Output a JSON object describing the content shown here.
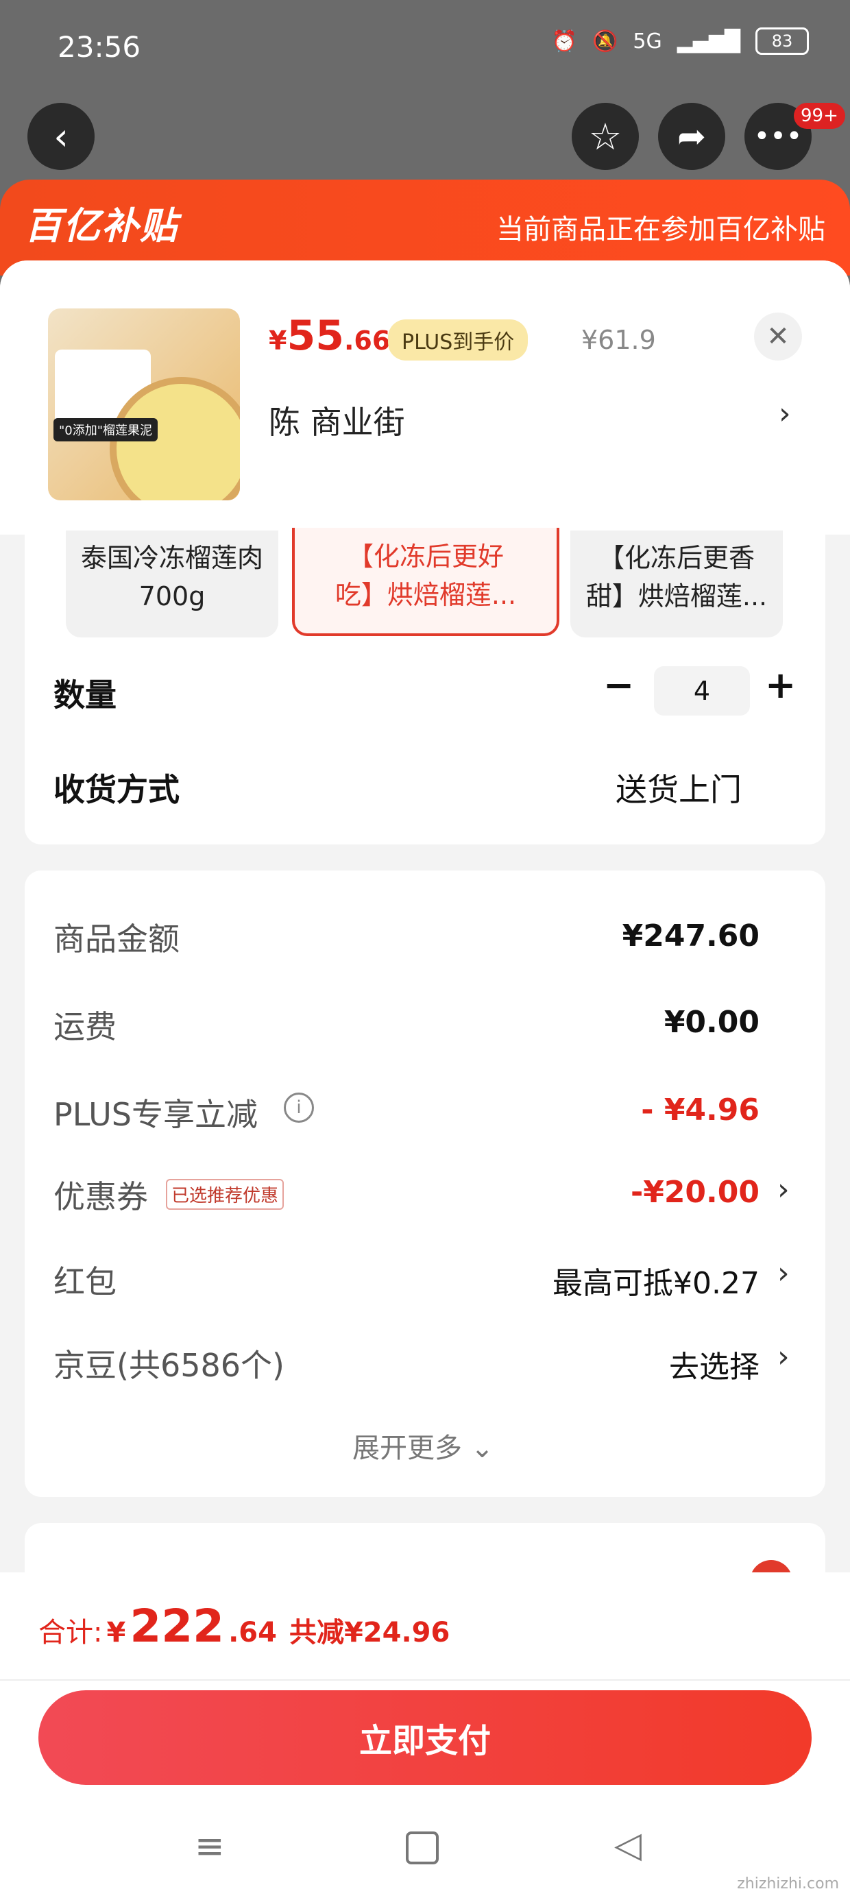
{
  "status_bar": {
    "time": "23:56",
    "network": "5G",
    "battery": "83"
  },
  "nav": {
    "badge": "99+"
  },
  "banner": {
    "logo": "百亿补贴",
    "text": "当前商品正在参加百亿补贴"
  },
  "product": {
    "price_symbol": "¥",
    "price_int": "55",
    "price_dec": ".66",
    "plus_tag": "PLUS到手价",
    "orig_price": "¥61.9",
    "address": "陈  商业街",
    "image_label": "\"0添加\"榴莲果泥"
  },
  "variants": [
    {
      "line1": "泰国冷冻榴莲肉",
      "line2": "700g"
    },
    {
      "line1": "【化冻后更好",
      "line2": "吃】烘焙榴莲..."
    },
    {
      "line1": "【化冻后更香",
      "line2": "甜】烘焙榴莲..."
    }
  ],
  "quantity": {
    "label": "数量",
    "value": "4"
  },
  "delivery": {
    "label": "收货方式",
    "value": "送货上门"
  },
  "summary": {
    "goods_label": "商品金额",
    "goods_value": "¥247.60",
    "shipping_label": "运费",
    "shipping_value": "¥0.00",
    "plus_label": "PLUS专享立减",
    "plus_value": "- ¥4.96",
    "coupon_label": "优惠券",
    "coupon_tag": "已选推荐优惠",
    "coupon_value": "-¥20.00",
    "hongbao_label": "红包",
    "hongbao_value": "最高可抵¥0.27",
    "jingdou_label": "京豆(共6586个)",
    "jingdou_value": "去选择",
    "expand": "展开更多"
  },
  "footer": {
    "total_label": "合计:",
    "total_symbol": "¥",
    "total_int": "222",
    "total_dec": ".64",
    "saved": "共减¥24.96",
    "pay": "立即支付"
  },
  "watermark": "zhizhizhi.com"
}
